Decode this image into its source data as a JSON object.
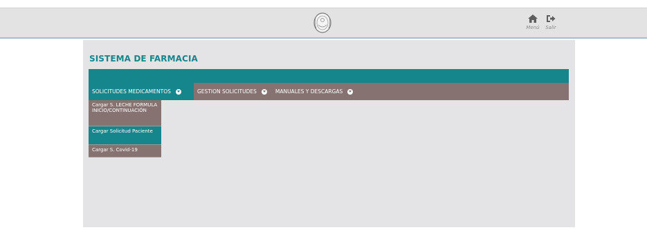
{
  "header": {
    "seal_icon": "provincial-seal-icon",
    "menu_label": "Menú",
    "exit_label": "Salir"
  },
  "page": {
    "title": "SISTEMA DE FARMACIA"
  },
  "menu": {
    "items": [
      {
        "label": "SOLICITUDES MEDICAMENTOS",
        "active": true
      },
      {
        "label": "GESTION SOLICITUDES",
        "active": false
      },
      {
        "label": "MANUALES Y DESCARGAS",
        "active": false
      }
    ]
  },
  "dropdown": {
    "items": [
      {
        "label": "Cargar S. LECHE FORMULA INICIO/CONTINUACIÓN"
      },
      {
        "label": "Cargar Solicitud Paciente",
        "highlighted": true
      },
      {
        "label": "Cargar S. Covid-19"
      }
    ]
  },
  "colors": {
    "teal": "#15868c",
    "menu_brown": "#867271",
    "panel_bg": "#e4e4e7",
    "title": "#17858a"
  }
}
